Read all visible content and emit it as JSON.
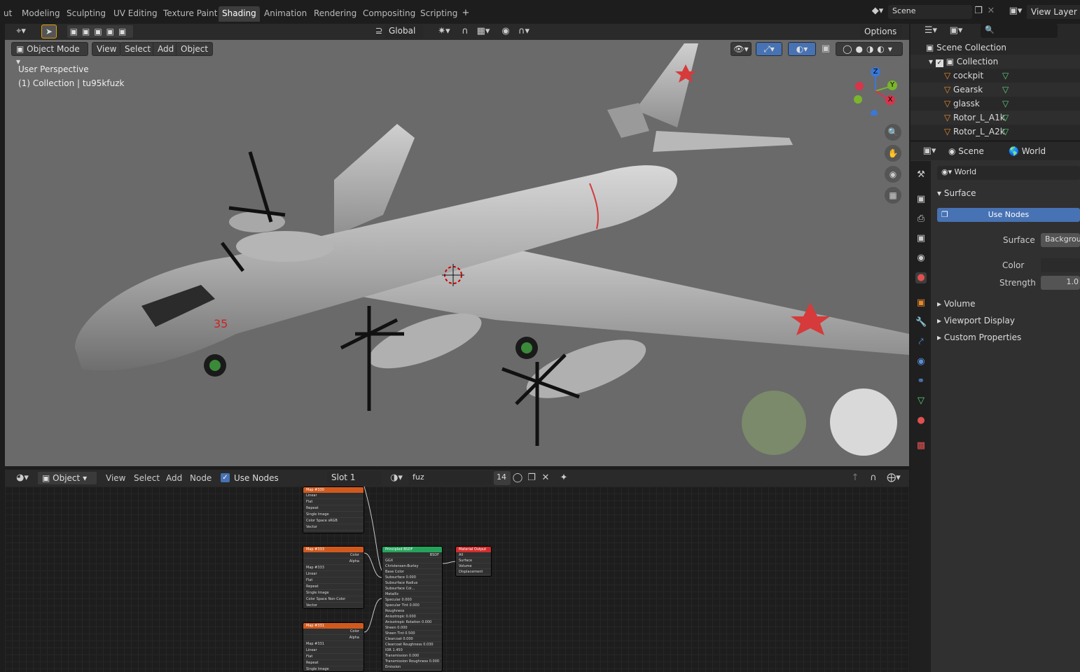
{
  "workspace_tabs": [
    "ut",
    "Modeling",
    "Sculpting",
    "UV Editing",
    "Texture Paint",
    "Shading",
    "Animation",
    "Rendering",
    "Compositing",
    "Scripting"
  ],
  "active_tab": "Shading",
  "scene_name": "Scene",
  "view_layer": "View Layer",
  "viewport": {
    "transform": "Global",
    "options": "Options",
    "mode": "Object Mode",
    "menus": [
      "View",
      "Select",
      "Add",
      "Object"
    ],
    "perspective": "User Perspective",
    "collection": "(1) Collection | tu95kfuzk",
    "tail_number": "35",
    "gizmo": {
      "z": "Z",
      "y": "Y",
      "x": "X"
    }
  },
  "node_editor": {
    "type": "Object",
    "menus": [
      "View",
      "Select",
      "Add",
      "Node"
    ],
    "use_nodes": "Use Nodes",
    "slot": "Slot 1",
    "material": "fuz",
    "users": "14",
    "nodes": {
      "map330": {
        "title": "Map #330",
        "rows": [
          "Linear",
          "Flat",
          "Repeat",
          "Single Image",
          "Color Space    sRGB",
          "Vector"
        ]
      },
      "map333": {
        "title": "Map #333",
        "out": [
          "Color",
          "Alpha"
        ],
        "rows": [
          "Map #333",
          "Linear",
          "Flat",
          "Repeat",
          "Single Image",
          "Color Space    Non-Color",
          "Vector"
        ]
      },
      "map331": {
        "title": "Map #331",
        "out": [
          "Color",
          "Alpha"
        ],
        "rows": [
          "Map #331",
          "Linear",
          "Flat",
          "Repeat",
          "Single Image"
        ]
      },
      "bsdf": {
        "title": "Principled BSDF",
        "out": "BSDF",
        "rows": [
          "GGX",
          "Christensen-Burley",
          "Base Color",
          "Subsurface       0.000",
          "Subsurface Radius",
          "Subsurface Col...",
          "Metallic",
          "Specular         0.000",
          "Specular Tint    0.000",
          "Roughness",
          "Anisotropic      0.000",
          "Anisotropic Rotation 0.000",
          "Sheen            0.000",
          "Sheen Tint       0.500",
          "Clearcoat        0.000",
          "Clearcoat Roughness 0.030",
          "IOR              1.450",
          "Transmission     0.000",
          "Transmission Roughness 0.000",
          "Emission"
        ]
      },
      "output": {
        "title": "Material Output",
        "rows": [
          "All",
          "Surface",
          "Volume",
          "Displacement"
        ]
      }
    }
  },
  "outliner": {
    "root": "Scene Collection",
    "collection": "Collection",
    "items": [
      "cockpit",
      "Gearsk",
      "glassk",
      "Rotor_L_A1k",
      "Rotor_L_A2k"
    ]
  },
  "properties": {
    "tabs": [
      "Scene",
      "World"
    ],
    "world_name": "World",
    "surface_panel": "Surface",
    "use_nodes": "Use Nodes",
    "surface_label": "Surface",
    "surface_value": "Backgroun",
    "color_label": "Color",
    "strength_label": "Strength",
    "strength_value": "1.0",
    "panels": [
      "Volume",
      "Viewport Display",
      "Custom Properties"
    ]
  },
  "colors": {
    "accent": "#4772b3",
    "node_image": "#d05a1e",
    "node_shader": "#25a35b",
    "node_output": "#d12d2d",
    "icon_orange": "#e8892d",
    "icon_green": "#5ad27d"
  }
}
